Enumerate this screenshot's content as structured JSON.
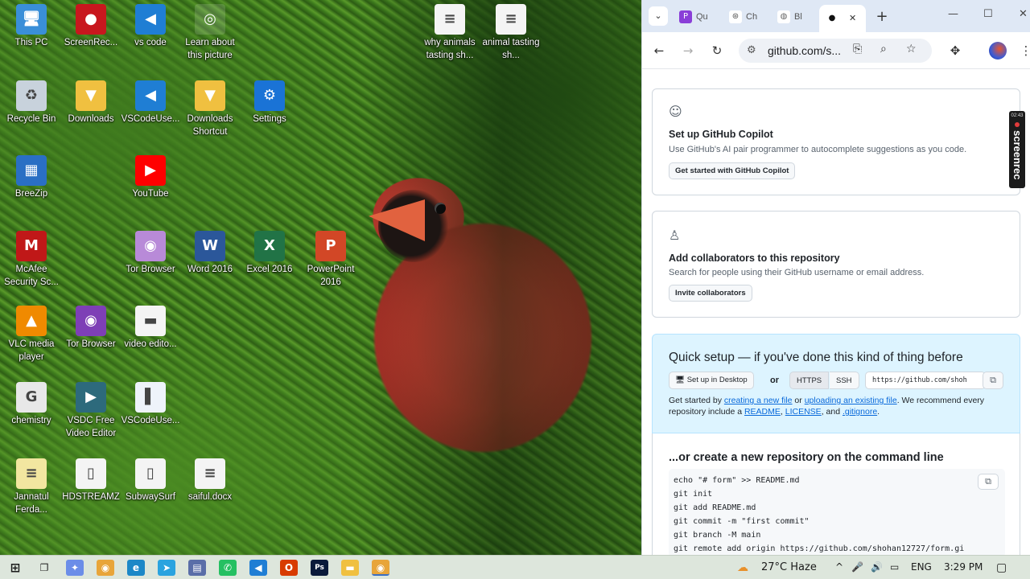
{
  "desktop": {
    "icons": [
      {
        "label": "This PC",
        "glyph": "🖥",
        "color": "#3a8fd8"
      },
      {
        "label": "ScreenRec...",
        "glyph": "●",
        "color": "#c8171e"
      },
      {
        "label": "vs code",
        "glyph": "◀",
        "color": "#1f7ed4"
      },
      {
        "label": "Learn about this picture",
        "glyph": "◎",
        "color": "rgba(255,255,255,0.15)"
      },
      {
        "label": "why animals tasting sh...",
        "glyph": "≡",
        "color": "#f4f4f4"
      },
      {
        "label": "animal tasting sh...",
        "glyph": "≡",
        "color": "#f4f4f4"
      },
      {
        "label": "Recycle Bin",
        "glyph": "♻",
        "color": "#c8d2dc"
      },
      {
        "label": "Downloads",
        "glyph": "▼",
        "color": "#f0c040"
      },
      {
        "label": "VSCodeUse...",
        "glyph": "◀",
        "color": "#1f7ed4"
      },
      {
        "label": "Downloads Shortcut",
        "glyph": "▼",
        "color": "#f0c040"
      },
      {
        "label": "Settings",
        "glyph": "⚙",
        "color": "#1a73d6"
      },
      {
        "label": "BreeZip",
        "glyph": "▦",
        "color": "#2a6fc4"
      },
      {
        "label": "YouTube",
        "glyph": "▶",
        "color": "#f00"
      },
      {
        "label": "McAfee Security Sc...",
        "glyph": "M",
        "color": "#c01818"
      },
      {
        "label": "Tor Browser",
        "glyph": "◉",
        "color": "#b88ad8"
      },
      {
        "label": "Word 2016",
        "glyph": "W",
        "color": "#2b579a"
      },
      {
        "label": "Excel 2016",
        "glyph": "X",
        "color": "#217346"
      },
      {
        "label": "PowerPoint 2016",
        "glyph": "P",
        "color": "#d24726"
      },
      {
        "label": "VLC media player",
        "glyph": "▲",
        "color": "#f08a00"
      },
      {
        "label": "Tor Browser",
        "glyph": "◉",
        "color": "#7e3fb6"
      },
      {
        "label": "video edito...",
        "glyph": "▬",
        "color": "#f4f4f4"
      },
      {
        "label": "chemistry",
        "glyph": "G",
        "color": "#e8e8e8"
      },
      {
        "label": "VSDC Free Video Editor",
        "glyph": "▶",
        "color": "#2d6a7c"
      },
      {
        "label": "VSCodeUse...",
        "glyph": "▌",
        "color": "#eef3fa"
      },
      {
        "label": "Jannatul Ferda...",
        "glyph": "≡",
        "color": "#f2e6a0"
      },
      {
        "label": "HDSTREAMZ",
        "glyph": "▯",
        "color": "#f4f4f4"
      },
      {
        "label": "SubwaySurf",
        "glyph": "▯",
        "color": "#f4f4f4"
      },
      {
        "label": "saiful.docx",
        "glyph": "≡",
        "color": "#f4f4f4"
      }
    ]
  },
  "browser": {
    "tabs": [
      {
        "label": "Qu",
        "icon": "quillbot-icon",
        "fav": "P",
        "color": "#8a3ed8"
      },
      {
        "label": "Ch",
        "icon": "chatgpt-icon",
        "fav": "⊛",
        "color": "#555"
      },
      {
        "label": "Bl",
        "icon": "globe-icon",
        "fav": "◍",
        "color": "#666"
      },
      {
        "label": "",
        "icon": "github-icon",
        "fav": "●",
        "color": "#111"
      }
    ],
    "tab_close": "✕",
    "new_tab": "+",
    "window": {
      "minimize": "—",
      "maximize": "☐",
      "close": "✕"
    },
    "url": "github.com/s..."
  },
  "copilot_card": {
    "title": "Set up GitHub Copilot",
    "desc": "Use GitHub's AI pair programmer to autocomplete suggestions as you code.",
    "button": "Get started with GitHub Copilot"
  },
  "collab_card": {
    "title": "Add collaborators to this repository",
    "desc": "Search for people using their GitHub username or email address.",
    "button": "Invite collaborators"
  },
  "quick_setup": {
    "title": "Quick setup — if you've done this kind of thing before",
    "desktop_button": "Set up in Desktop",
    "or": "or",
    "https": "HTTPS",
    "ssh": "SSH",
    "clone_url": "https://github.com/shoh",
    "text_1": "Get started by ",
    "link_new_file": "creating a new file",
    "text_2": " or ",
    "link_upload": "uploading an existing file",
    "text_3": ". We recommend every repository include a ",
    "link_readme": "README",
    "text_4": ", ",
    "link_license": "LICENSE",
    "text_5": ", and ",
    "link_gitignore": ".gitignore",
    "text_6": "."
  },
  "command_line": {
    "title": "...or create a new repository on the command line",
    "lines": [
      "echo \"# form\" >> README.md",
      "git init",
      "git add README.md",
      "git commit -m \"first commit\"",
      "git branch -M main",
      "git remote add origin https://github.com/shohan12727/form.gi"
    ]
  },
  "recorder_badge": {
    "time": "02:43",
    "label": "screenrec"
  },
  "taskbar": {
    "weather": "27°C  Haze",
    "lang": "ENG",
    "time": "3:29 PM",
    "tray_up": "^"
  }
}
